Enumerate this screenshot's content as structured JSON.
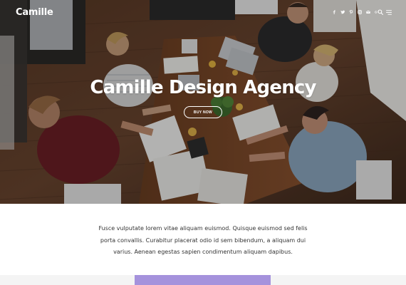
{
  "header": {
    "logo": "Camille",
    "social_icons": [
      "facebook-icon",
      "twitter-icon",
      "pinterest-icon",
      "instagram-icon",
      "mail-icon",
      "google-plus-icon"
    ],
    "search_icon": "search-icon",
    "menu_icon": "menu-icon"
  },
  "hero": {
    "title": "Camille Design Agency",
    "button_label": "BUY NOW"
  },
  "intro": {
    "text": "Fusce vulputate lorem vitae aliquam euismod. Quisque euismod sed felis porta convallis. Curabitur placerat odio id sem bibendum, a aliquam dui varius. Aenean egestas sapien condimentum aliquam dapibus."
  },
  "colors": {
    "accent_purple": "#a592dc",
    "text_dark": "#333333",
    "strip_gray": "#f4f4f4"
  }
}
